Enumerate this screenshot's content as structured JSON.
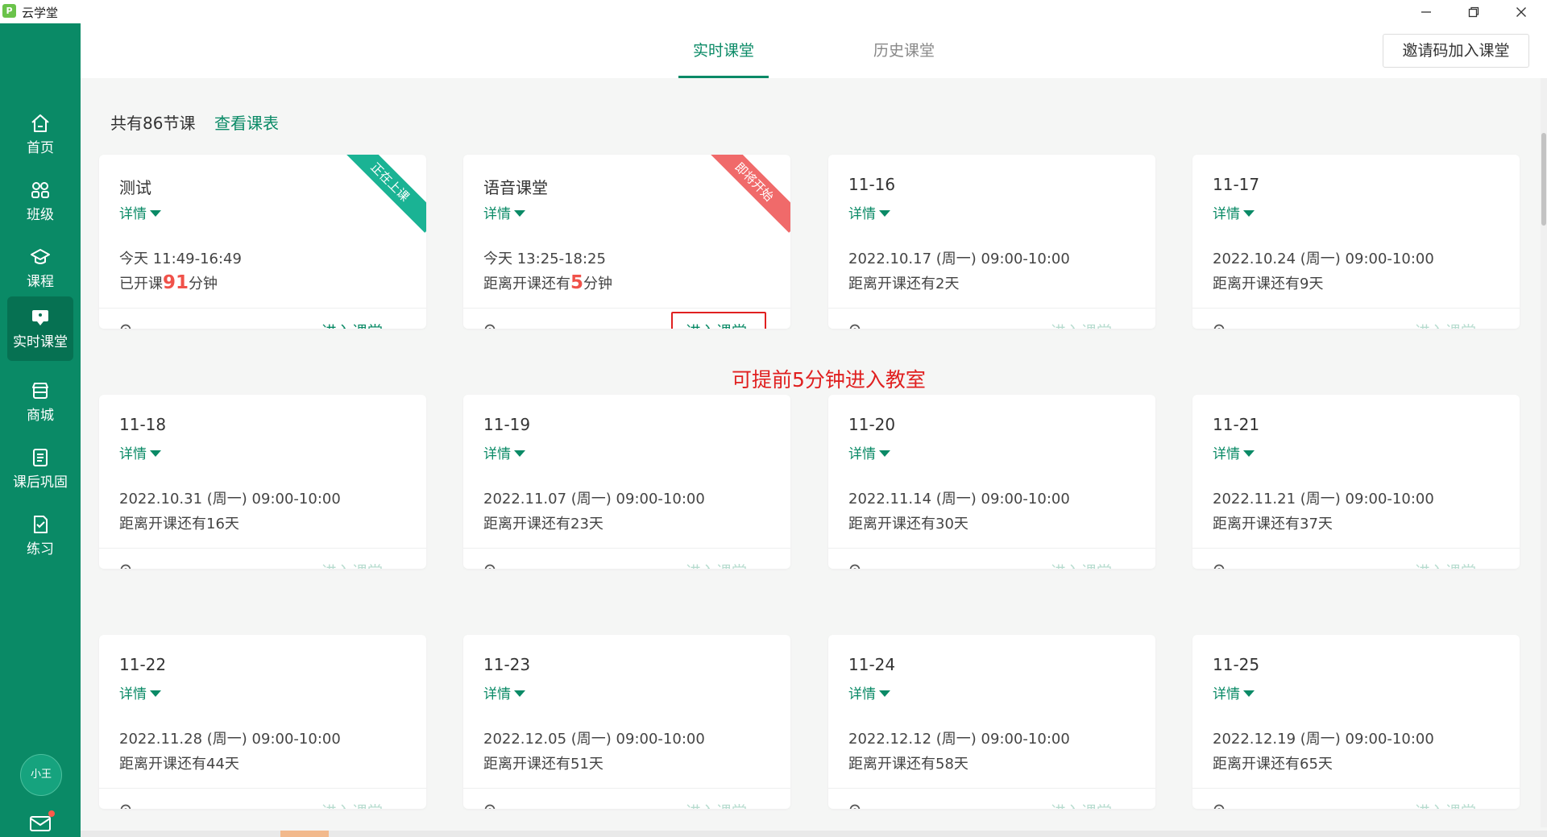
{
  "window": {
    "title": "云学堂",
    "logo_char": "P"
  },
  "sidebar": {
    "items": [
      {
        "label": "首页",
        "icon": "home-icon"
      },
      {
        "label": "班级",
        "icon": "class-icon"
      },
      {
        "label": "课程",
        "icon": "graduation-cap-icon"
      },
      {
        "label": "实时课堂",
        "icon": "live-classroom-icon",
        "active": true
      },
      {
        "label": "商城",
        "icon": "store-icon"
      },
      {
        "label": "课后巩固",
        "icon": "review-list-icon"
      },
      {
        "label": "练习",
        "icon": "exercise-icon"
      }
    ],
    "avatar": "小王",
    "mail_icon": "mail-icon"
  },
  "header": {
    "tabs": [
      {
        "label": "实时课堂",
        "active": true
      },
      {
        "label": "历史课堂",
        "active": false
      }
    ],
    "invite_button": "邀请码加入课堂"
  },
  "summary": {
    "count_text": "共有86节课",
    "schedule_link": "查看课表"
  },
  "colors": {
    "brand": "#0a8a66",
    "highlight": "#f0524a",
    "annotation": "#e02020"
  },
  "detail_label": "详情",
  "enter_label": "进入课堂",
  "cards": [
    {
      "title": "测试",
      "time": "今天 11:49-16:49",
      "status_pre": "已开课",
      "status_num": "91",
      "status_post": "分钟",
      "ribbon": "正在上课",
      "enter_enabled": true
    },
    {
      "title": "语音课堂",
      "time": "今天 13:25-18:25",
      "status_pre": "距离开课还有",
      "status_num": "5",
      "status_post": "分钟",
      "ribbon": "即将开始",
      "enter_enabled": true
    },
    {
      "title": "11-16",
      "time": "2022.10.17 (周一) 09:00-10:00",
      "status": "距离开课还有2天",
      "enter_enabled": false
    },
    {
      "title": "11-17",
      "time": "2022.10.24 (周一) 09:00-10:00",
      "status": "距离开课还有9天",
      "enter_enabled": false
    },
    {
      "title": "11-18",
      "time": "2022.10.31 (周一) 09:00-10:00",
      "status": "距离开课还有16天",
      "enter_enabled": false
    },
    {
      "title": "11-19",
      "time": "2022.11.07 (周一) 09:00-10:00",
      "status": "距离开课还有23天",
      "enter_enabled": false
    },
    {
      "title": "11-20",
      "time": "2022.11.14 (周一) 09:00-10:00",
      "status": "距离开课还有30天",
      "enter_enabled": false
    },
    {
      "title": "11-21",
      "time": "2022.11.21 (周一) 09:00-10:00",
      "status": "距离开课还有37天",
      "enter_enabled": false
    },
    {
      "title": "11-22",
      "time": "2022.11.28 (周一) 09:00-10:00",
      "status": "距离开课还有44天",
      "enter_enabled": false
    },
    {
      "title": "11-23",
      "time": "2022.12.05 (周一) 09:00-10:00",
      "status": "距离开课还有51天",
      "enter_enabled": false
    },
    {
      "title": "11-24",
      "time": "2022.12.12 (周一) 09:00-10:00",
      "status": "距离开课还有58天",
      "enter_enabled": false
    },
    {
      "title": "11-25",
      "time": "2022.12.19 (周一) 09:00-10:00",
      "status": "距离开课还有65天",
      "enter_enabled": false
    }
  ],
  "annotation": "可提前5分钟进入教室"
}
